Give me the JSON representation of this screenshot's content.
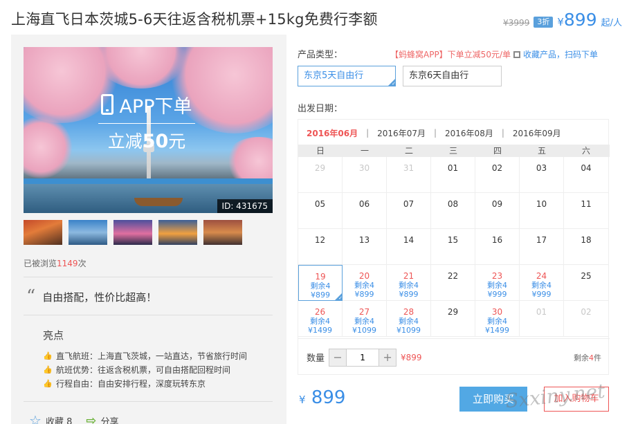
{
  "header": {
    "title": "上海直飞日本茨城5-6天往返含税机票+15kg免费行李额",
    "original_price": "¥3999",
    "discount": "3折",
    "currency": "¥",
    "price": "899",
    "unit": "起/人"
  },
  "gallery": {
    "banner_app": "APP下单",
    "banner_off": "立减",
    "banner_amount": "50",
    "banner_unit": "元",
    "id_label": "ID: 431675",
    "thumbs": [
      "thumb-pagoda",
      "thumb-fuji",
      "thumb-tower-night",
      "thumb-temple",
      "thumb-street"
    ]
  },
  "stats": {
    "views_prefix": "已被浏览",
    "views_count": "1149",
    "views_suffix": "次"
  },
  "quote": "自由搭配，性价比超高！",
  "highlights": {
    "title": "亮点",
    "items": [
      "直飞航班：上海直飞茨城，一站直达，节省旅行时间",
      "航班优势：往返含税机票，可自由搭配回程时间",
      "行程自由：自由安排行程，深度玩转东京"
    ]
  },
  "actions": {
    "fav": "收藏 8",
    "share": "分享"
  },
  "product": {
    "type_label": "产品类型：",
    "promo_app": "【蚂蜂窝APP】下单立减50元/单",
    "promo_fav": "收藏产品，扫码下单",
    "options": [
      "东京5天自由行",
      "东京6天自由行"
    ]
  },
  "dates": {
    "label": "出发日期：",
    "months": [
      "2016年06月",
      "2016年07月",
      "2016年08月",
      "2016年09月"
    ],
    "weekdays": [
      "日",
      "一",
      "二",
      "三",
      "四",
      "五",
      "六"
    ],
    "rows": [
      [
        {
          "d": "29",
          "o": true
        },
        {
          "d": "30",
          "o": true
        },
        {
          "d": "31",
          "o": true
        },
        {
          "d": "01"
        },
        {
          "d": "02"
        },
        {
          "d": "03"
        },
        {
          "d": "04"
        }
      ],
      [
        {
          "d": "05"
        },
        {
          "d": "06"
        },
        {
          "d": "07"
        },
        {
          "d": "08"
        },
        {
          "d": "09"
        },
        {
          "d": "10"
        },
        {
          "d": "11"
        }
      ],
      [
        {
          "d": "12"
        },
        {
          "d": "13"
        },
        {
          "d": "14"
        },
        {
          "d": "15"
        },
        {
          "d": "16"
        },
        {
          "d": "17"
        },
        {
          "d": "18"
        }
      ],
      [
        {
          "d": "19",
          "a": true,
          "s": "剩余4",
          "p": "¥899",
          "sel": true
        },
        {
          "d": "20",
          "a": true,
          "s": "剩余4",
          "p": "¥899"
        },
        {
          "d": "21",
          "a": true,
          "s": "剩余4",
          "p": "¥899"
        },
        {
          "d": "22"
        },
        {
          "d": "23",
          "a": true,
          "s": "剩余4",
          "p": "¥999"
        },
        {
          "d": "24",
          "a": true,
          "s": "剩余4",
          "p": "¥999"
        },
        {
          "d": "25"
        }
      ],
      [
        {
          "d": "26",
          "a": true,
          "s": "剩余4",
          "p": "¥1499"
        },
        {
          "d": "27",
          "a": true,
          "s": "剩余4",
          "p": "¥1099"
        },
        {
          "d": "28",
          "a": true,
          "s": "剩余4",
          "p": "¥1099"
        },
        {
          "d": "29"
        },
        {
          "d": "30",
          "a": true,
          "s": "剩余4",
          "p": "¥1499"
        },
        {
          "d": "01",
          "o": true
        },
        {
          "d": "02",
          "o": true
        }
      ]
    ]
  },
  "quantity": {
    "label": "数量",
    "minus": "−",
    "value": "1",
    "plus": "+",
    "price": "¥899",
    "left_prefix": "剩余",
    "left_count": "4",
    "left_suffix": "件"
  },
  "footer": {
    "currency": "¥",
    "total": "899",
    "buy_label": "立即购买",
    "cart_label": "加入购物车",
    "watermark": "Sxxiny.net"
  }
}
